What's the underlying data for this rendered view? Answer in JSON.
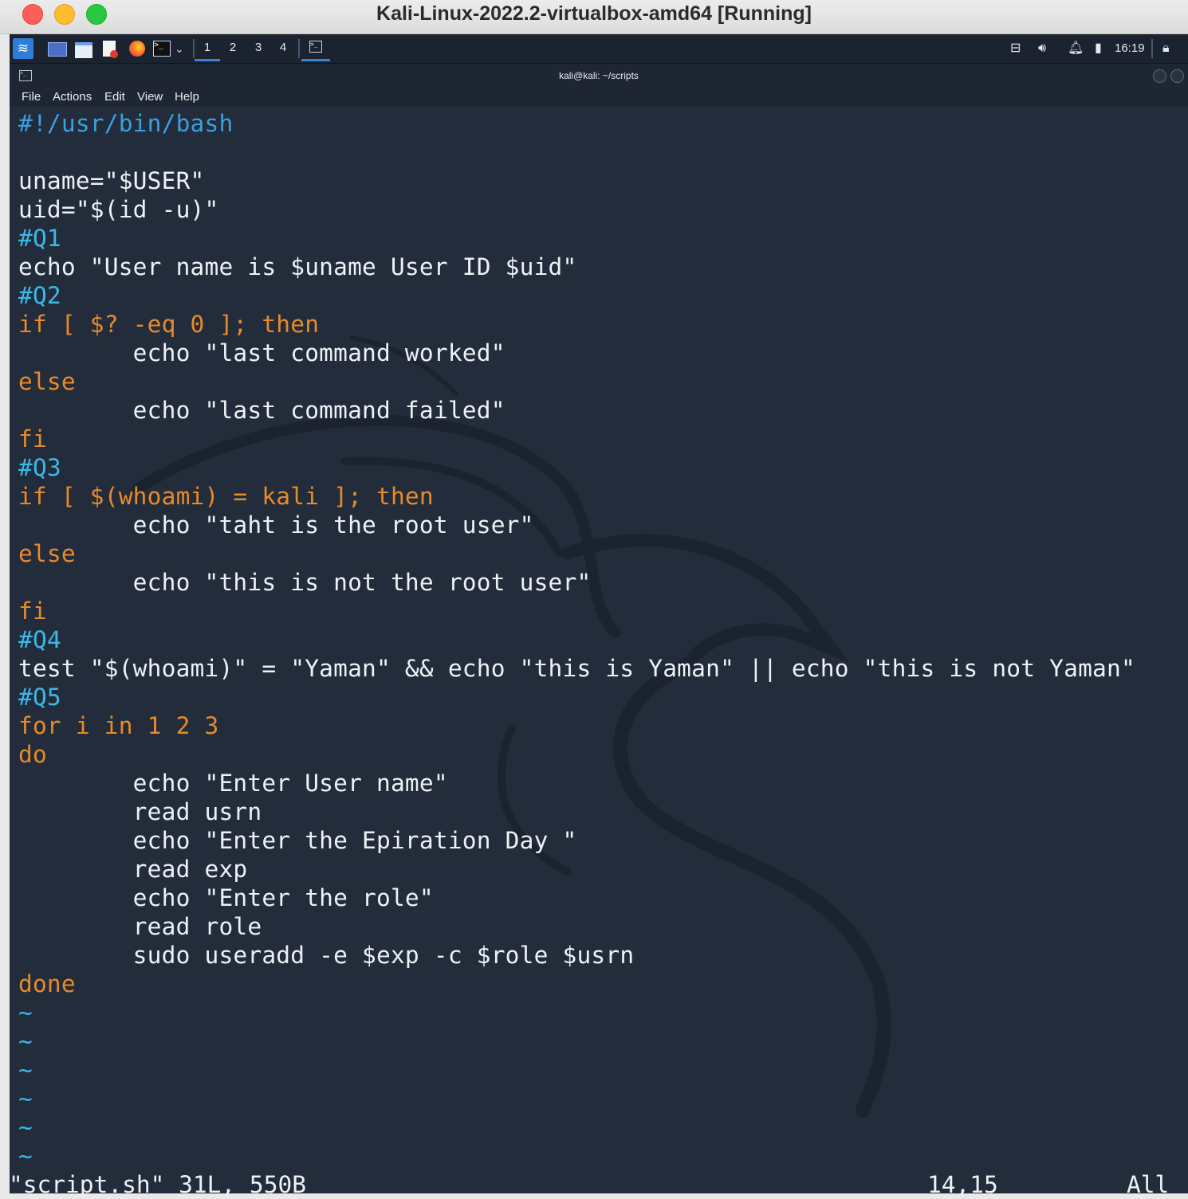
{
  "window": {
    "title": "Kali-Linux-2022.2-virtualbox-amd64 [Running]"
  },
  "panel": {
    "workspaces": [
      "1",
      "2",
      "3",
      "4"
    ],
    "active_workspace": "1",
    "clock": "16:19",
    "icons": [
      "kali-menu-icon",
      "show-desktop-icon",
      "file-manager-icon",
      "text-editor-icon",
      "firefox-icon",
      "terminal-icon",
      "chevron-down-icon",
      "network-icon",
      "volume-icon",
      "notifications-icon",
      "battery-icon",
      "lock-icon"
    ]
  },
  "terminal": {
    "title": "kali@kali: ~/scripts",
    "menu": [
      "File",
      "Actions",
      "Edit",
      "View",
      "Help"
    ]
  },
  "code_lines": [
    "#!/usr/bin/bash",
    "",
    "uname=\"$USER\"",
    "uid=\"$(id -u)\"",
    "#Q1",
    "echo \"User name is $uname User ID $uid\"",
    "#Q2",
    "if [ $? -eq 0 ]; then",
    "        echo \"last command worked\"",
    "else",
    "        echo \"last command failed\"",
    "fi",
    "#Q3",
    "if [ $(whoami) = kali ]; then",
    "        echo \"taht is the root user\"",
    "else",
    "        echo \"this is not the root user\"",
    "fi",
    "#Q4",
    "test \"$(whoami)\" = \"Yaman\" && echo \"this is Yaman\" || echo \"this is not Yaman\"",
    "#Q5",
    "for i in 1 2 3",
    "do",
    "        echo \"Enter User name\"",
    "        read usrn",
    "        echo \"Enter the Epiration Day \"",
    "        read exp",
    "        echo \"Enter the role\"",
    "        read role",
    "        sudo useradd -e $exp -c $role $usrn",
    "done"
  ],
  "tilde_lines": [
    "~",
    "~",
    "~",
    "~",
    "~",
    "~"
  ],
  "status": {
    "file": "\"script.sh\" 31L, 550B",
    "position": "14,15",
    "scroll": "All"
  },
  "colors": {
    "keyword": "#e88a2a",
    "string": "#a357d0",
    "variable": "#3ab8e8",
    "background": "#232c3a"
  }
}
